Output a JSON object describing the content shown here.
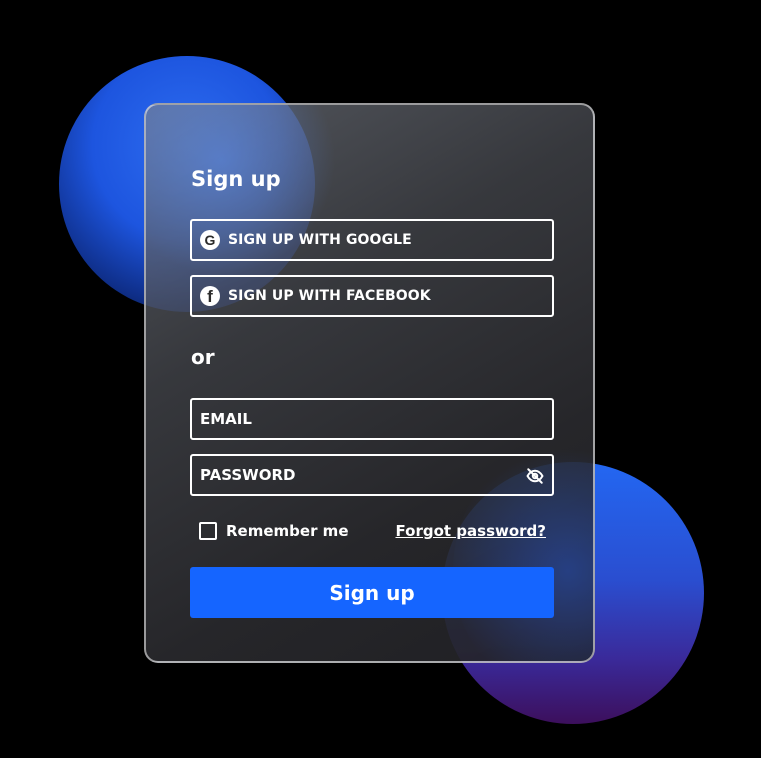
{
  "form": {
    "title": "Sign up",
    "google_button": "SIGN UP WITH GOOGLE",
    "facebook_button": "SIGN UP WITH FACEBOOK",
    "divider": "or",
    "email_placeholder": "EMAIL",
    "password_placeholder": "PASSWORD",
    "remember_me": "Remember me",
    "remember_checked": false,
    "forgot_password": "Forgot password?",
    "submit_label": "Sign up"
  },
  "icons": {
    "google": "google-icon",
    "facebook": "facebook-icon",
    "password_toggle": "eye-off-icon"
  },
  "colors": {
    "background": "#000000",
    "accent": "#1565ff",
    "orb_blue": "#1d55df",
    "orb_purple": "#3c0f5c"
  }
}
